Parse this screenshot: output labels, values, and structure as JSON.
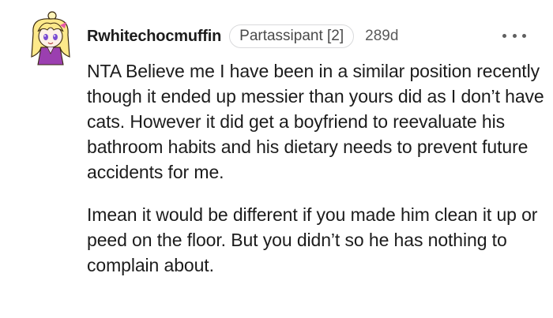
{
  "comment": {
    "username": "Rwhitechocmuffin",
    "flair": "Partassipant [2]",
    "age": "289d",
    "paragraphs": [
      "NTA Believe me I have been in a similar position recently though it ended up messier than yours did as I don’t have cats. However it did get a boyfriend to reevaluate his bathroom habits and his dietary needs to prevent future accidents for me.",
      "Imean it would be different if you made him clean it up or peed on the floor. But you didn’t so he has nothing to complain about."
    ]
  },
  "icons": {
    "avatar": "anime-avatar-icon",
    "more": "more-options-icon"
  },
  "colors": {
    "text": "#1c1c1c",
    "meta": "#5a5a5a",
    "flair_border": "#d9dadc"
  }
}
